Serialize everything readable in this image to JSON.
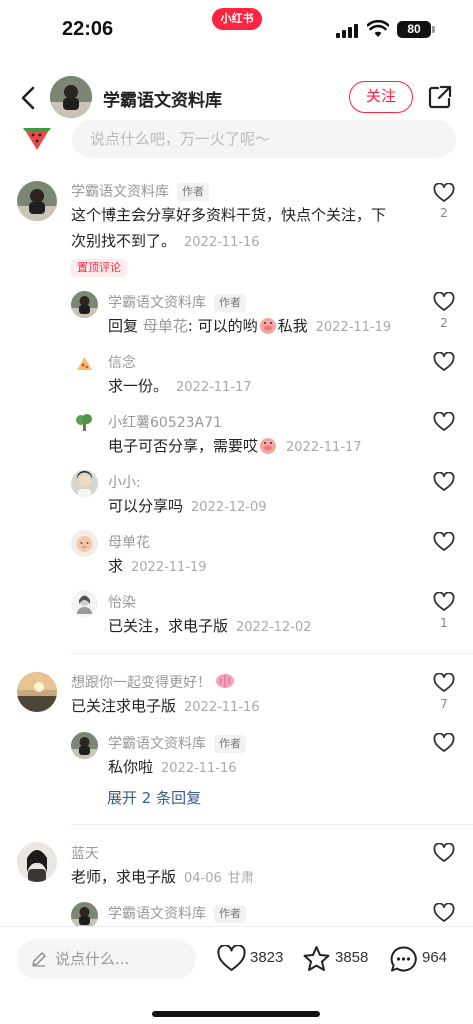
{
  "status": {
    "time": "22:06",
    "app": "小红书",
    "battery": "80"
  },
  "header": {
    "name": "学霸语文资料库",
    "follow": "关注"
  },
  "top_input": {
    "placeholder": "说点什么吧，万一火了呢～"
  },
  "comments": [
    {
      "name": "学霸语文资料库",
      "tag": "作者",
      "text1": "这个博主会分享好多资料干货，快点个关注，下",
      "text2": "次别找不到了。",
      "date": "2022-11-16",
      "pin": "置顶评论",
      "likes": "2",
      "replies": [
        {
          "name": "学霸语文资料库",
          "tag": "作者",
          "text_a": "回复 ",
          "reply_to": "母单花",
          "text_b": ": 可以的哟",
          "text_c": "私我",
          "date": "2022-11-19",
          "likes": "2"
        },
        {
          "name": "信念",
          "text": "求一份。",
          "date": "2022-11-17"
        },
        {
          "name": "小红薯60523A71",
          "text": "电子可否分享，需要哎",
          "date": "2022-11-17"
        },
        {
          "name": "小小:",
          "text": "可以分享吗",
          "date": "2022-12-09"
        },
        {
          "name": "母单花",
          "text": "求",
          "date": "2022-11-19"
        },
        {
          "name": "怡染",
          "text": "已关注，求电子版",
          "date": "2022-12-02",
          "likes": "1"
        }
      ]
    },
    {
      "name": "想跟你一起变得更好！",
      "text": "已关注求电子版",
      "date": "2022-11-16",
      "likes": "7",
      "replies": [
        {
          "name": "学霸语文资料库",
          "tag": "作者",
          "text": "私你啦",
          "date": "2022-11-16"
        }
      ],
      "expand": "展开 2 条回复"
    },
    {
      "name": "蓝天",
      "text": "老师，求电子版",
      "date": "04-06",
      "location": "甘肃",
      "replies": [
        {
          "name": "学霸语文资料库",
          "tag": "作者"
        }
      ]
    }
  ],
  "bottom": {
    "placeholder": "说点什么...",
    "likes": "3823",
    "stars": "3858",
    "comments": "964"
  },
  "colors": {
    "brand": "#ff2442",
    "link": "#3b5c86"
  }
}
